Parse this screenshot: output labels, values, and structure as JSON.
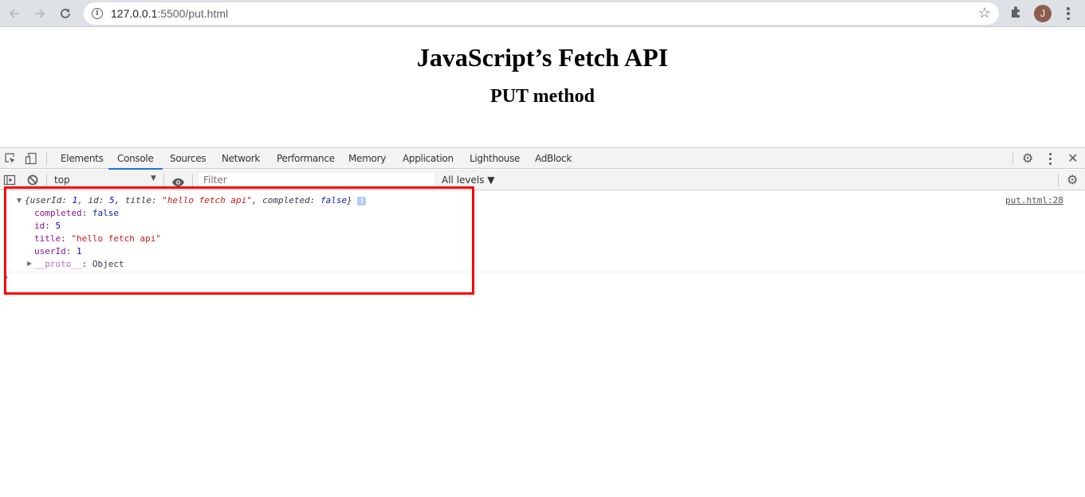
{
  "browser": {
    "url_host": "127.0.0.1",
    "url_rest": ":5500/put.html",
    "avatar_initial": "J",
    "icons": {
      "back": "arrow-left-icon",
      "forward": "arrow-right-icon",
      "reload": "reload-icon",
      "site_info": "info-icon",
      "bookmark": "star-icon",
      "extensions": "puzzle-icon",
      "menu": "kebab-menu-icon"
    }
  },
  "page": {
    "heading": "JavaScript’s Fetch API",
    "subheading": "PUT method"
  },
  "devtools": {
    "tabs": [
      {
        "label": "Elements",
        "active": false
      },
      {
        "label": "Console",
        "active": true
      },
      {
        "label": "Sources",
        "active": false
      },
      {
        "label": "Network",
        "active": false
      },
      {
        "label": "Performance",
        "active": false
      },
      {
        "label": "Memory",
        "active": false
      },
      {
        "label": "Application",
        "active": false
      },
      {
        "label": "Lighthouse",
        "active": false
      },
      {
        "label": "AdBlock",
        "active": false
      }
    ],
    "toolbar": {
      "context": "top",
      "filter_placeholder": "Filter",
      "levels": "All levels ▼"
    },
    "console": {
      "source": "put.html:28",
      "summary": {
        "open": "{",
        "k1": "userId",
        "v1": "1",
        "k2": "id",
        "v2": "5",
        "k3": "title",
        "v3": "\"hello fetch api\"",
        "k4": "completed",
        "v4": "false",
        "close": "}",
        "info_badge": "i"
      },
      "properties": [
        {
          "key": "completed",
          "value": "false",
          "type": "boolean"
        },
        {
          "key": "id",
          "value": "5",
          "type": "number"
        },
        {
          "key": "title",
          "value": "\"hello fetch api\"",
          "type": "string"
        },
        {
          "key": "userId",
          "value": "1",
          "type": "number"
        }
      ],
      "proto": {
        "key": "__proto__",
        "value": "Object"
      }
    }
  },
  "annotation": {
    "highlight_color": "#ff0000"
  }
}
